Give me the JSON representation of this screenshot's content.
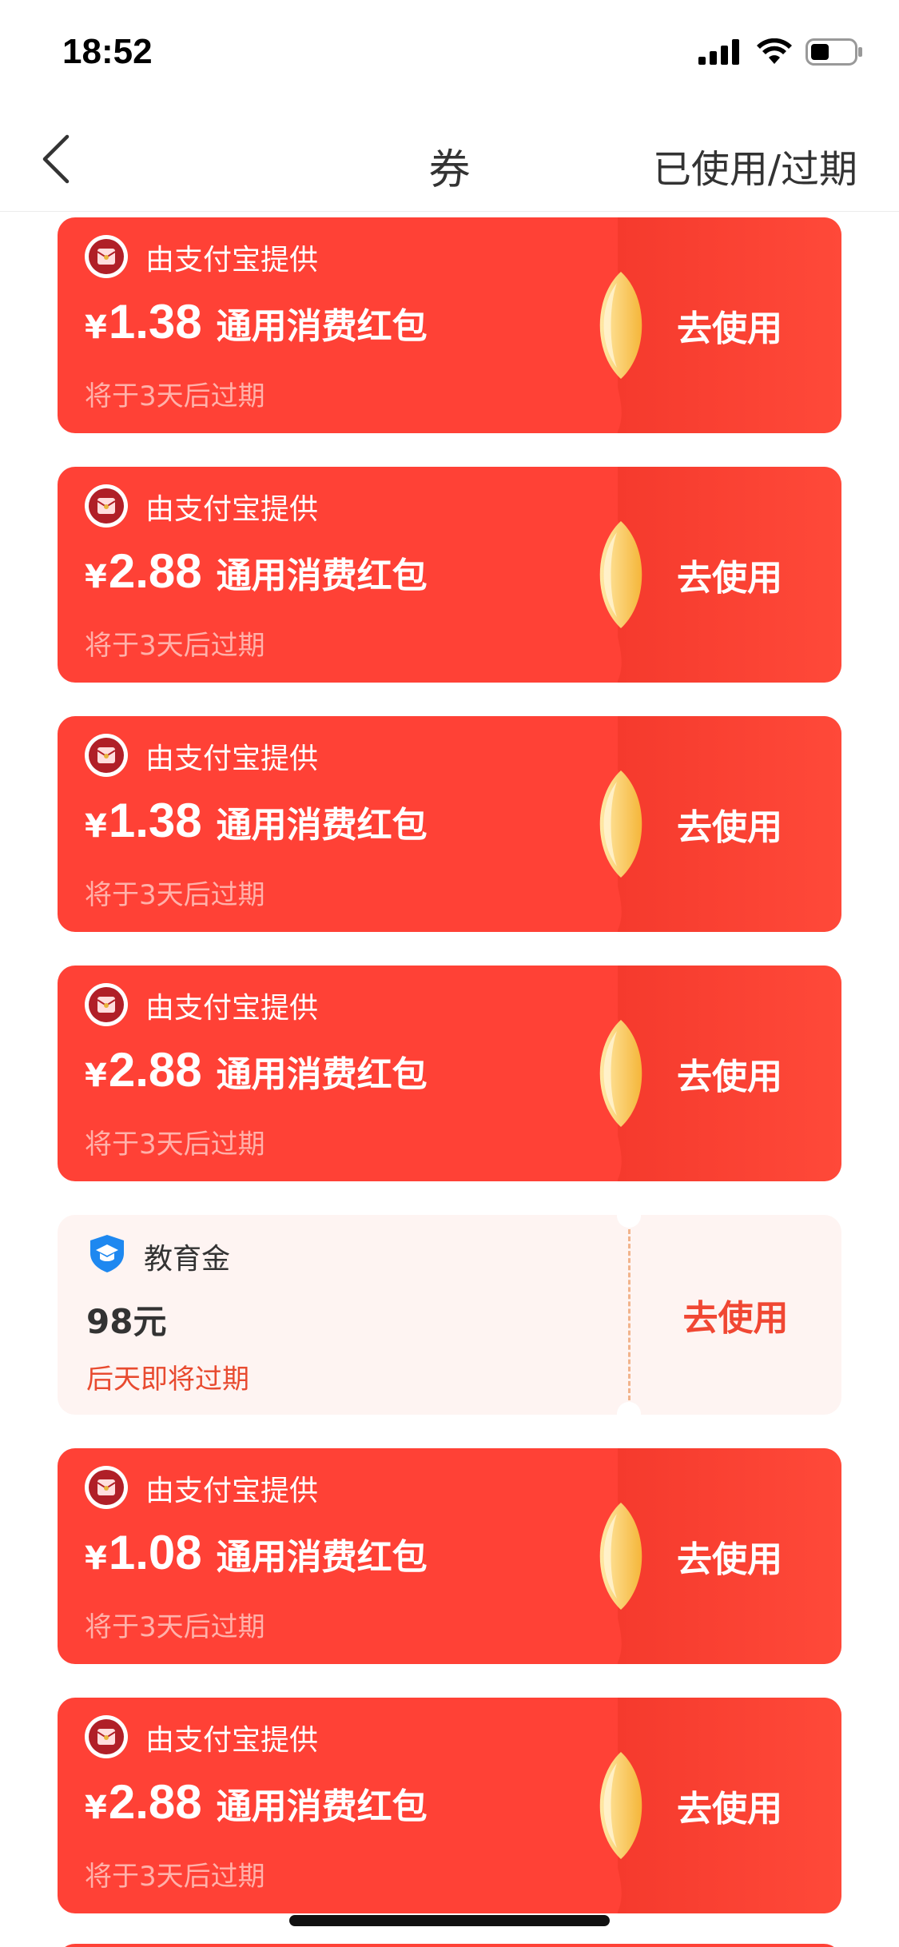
{
  "status_bar": {
    "time": "18:52"
  },
  "nav": {
    "title": "券",
    "right_label": "已使用/过期"
  },
  "coupons": [
    {
      "provider": "由支付宝提供",
      "currency": "¥",
      "amount": "1.38",
      "type": "通用消费红包",
      "expire": "将于3天后过期",
      "button": "去使用"
    },
    {
      "provider": "由支付宝提供",
      "currency": "¥",
      "amount": "2.88",
      "type": "通用消费红包",
      "expire": "将于3天后过期",
      "button": "去使用"
    },
    {
      "provider": "由支付宝提供",
      "currency": "¥",
      "amount": "1.38",
      "type": "通用消费红包",
      "expire": "将于3天后过期",
      "button": "去使用"
    },
    {
      "provider": "由支付宝提供",
      "currency": "¥",
      "amount": "2.88",
      "type": "通用消费红包",
      "expire": "将于3天后过期",
      "button": "去使用"
    },
    {
      "provider": "由支付宝提供",
      "currency": "¥",
      "amount": "1.08",
      "type": "通用消费红包",
      "expire": "将于3天后过期",
      "button": "去使用"
    },
    {
      "provider": "由支付宝提供",
      "currency": "¥",
      "amount": "2.88",
      "type": "通用消费红包",
      "expire": "将于3天后过期",
      "button": "去使用"
    }
  ],
  "edu_coupon": {
    "title": "教育金",
    "amount": "98元",
    "expire": "后天即将过期",
    "button": "去使用"
  },
  "colors": {
    "card_red": "#ff4136",
    "edu_bg": "#fef4f2",
    "edu_accent": "#f04733"
  }
}
